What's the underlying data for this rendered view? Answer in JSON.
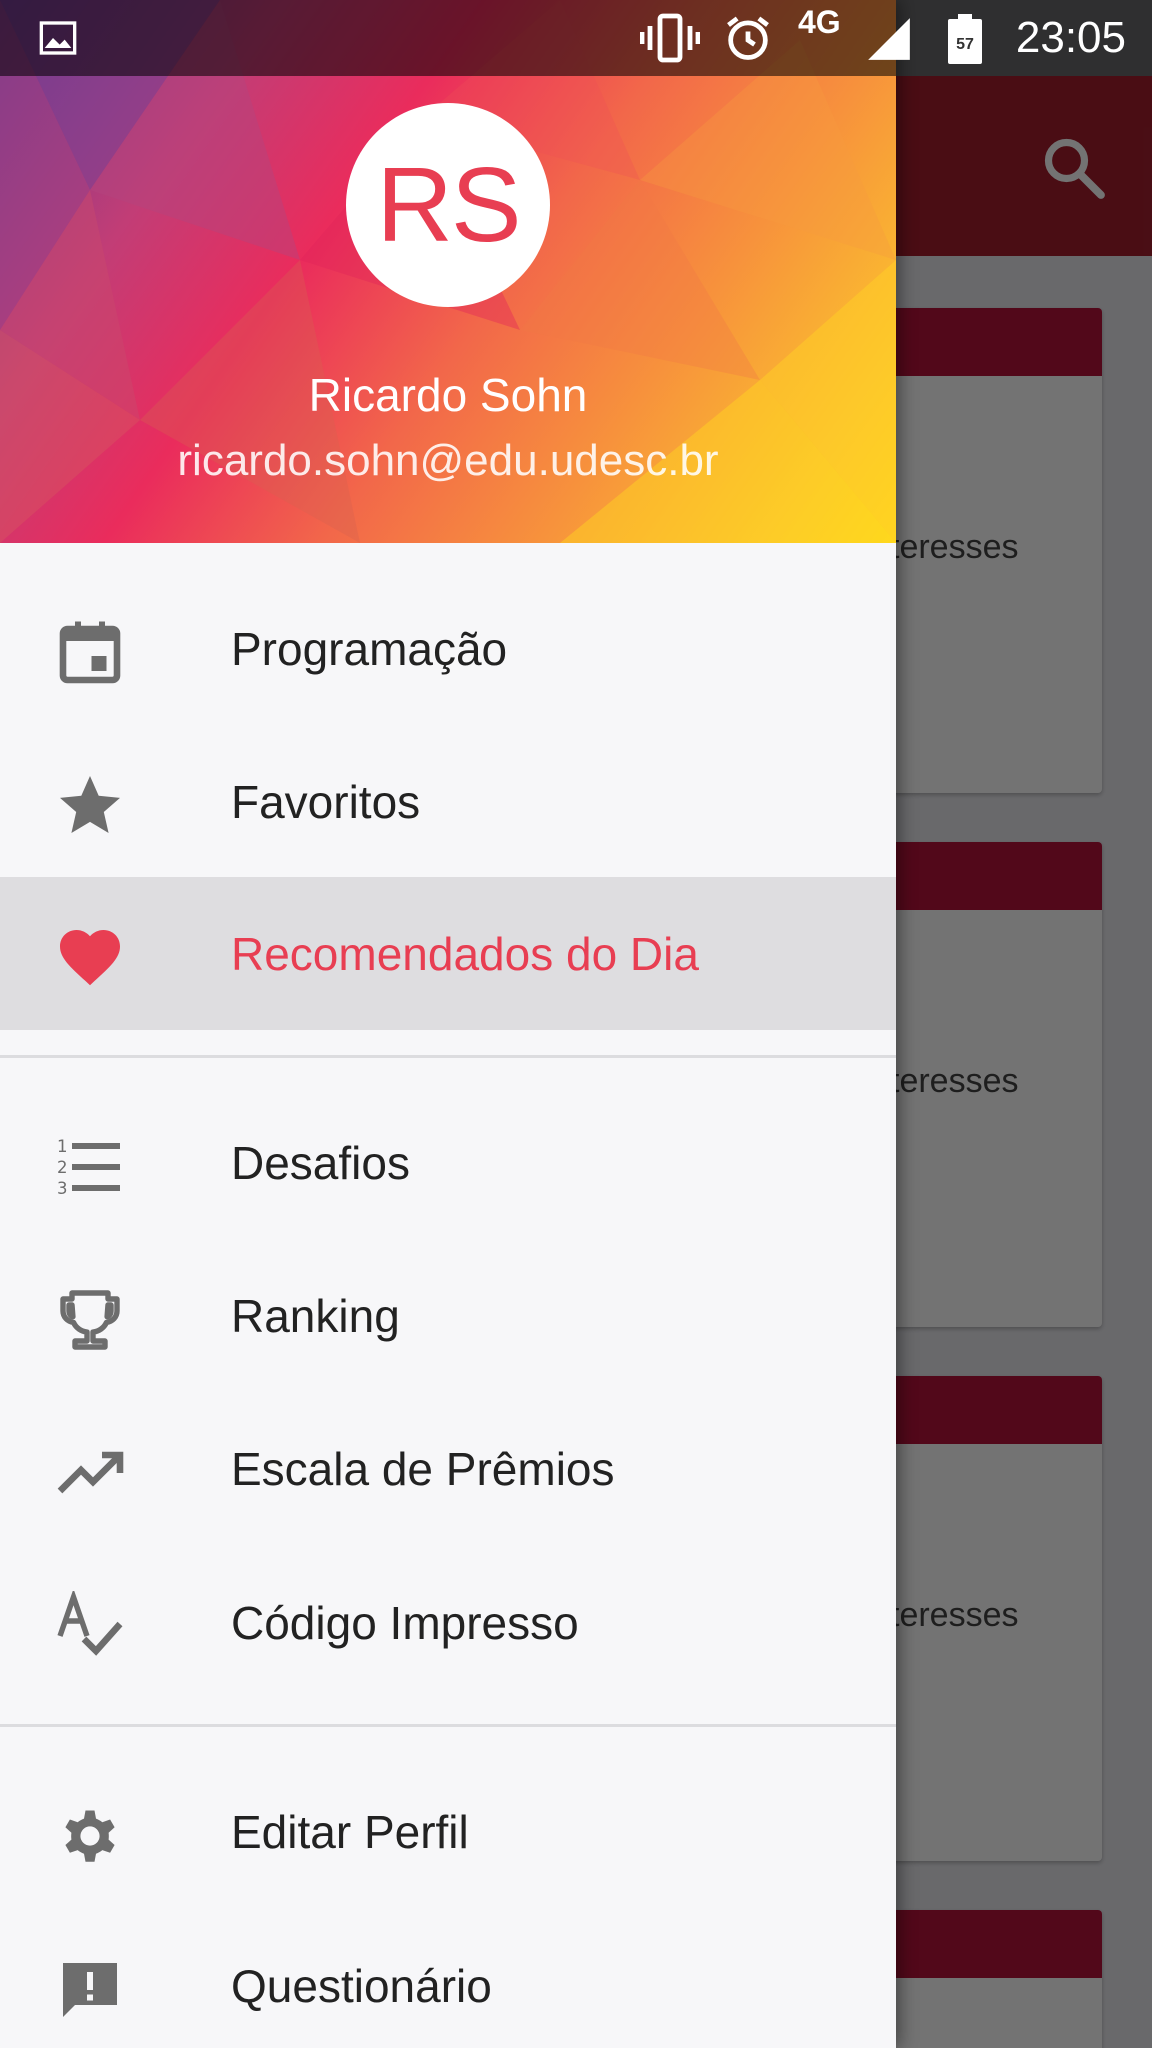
{
  "status_bar": {
    "time": "23:05",
    "network": "4G",
    "battery_level": "57",
    "icons": [
      "image-icon",
      "vibrate-icon",
      "alarm-icon",
      "signal-icon",
      "battery-icon"
    ]
  },
  "background": {
    "card_snippets": [
      "teresses",
      "teresses",
      "teresses"
    ],
    "toolbar_color": "#a51e2e",
    "card_header_color": "#b5123a"
  },
  "drawer": {
    "header": {
      "avatar_initials": "RS",
      "name": "Ricardo Sohn",
      "email": "ricardo.sohn@edu.udesc.br"
    },
    "items": [
      {
        "label": "Programação",
        "icon": "calendar-icon"
      },
      {
        "label": "Favoritos",
        "icon": "star-icon"
      },
      {
        "label": "Recomendados do Dia",
        "icon": "heart-icon",
        "active": true
      },
      {
        "label": "Desafios",
        "icon": "numbered-list-icon"
      },
      {
        "label": "Ranking",
        "icon": "trophy-icon"
      },
      {
        "label": "Escala de Prêmios",
        "icon": "trending-up-icon"
      },
      {
        "label": "Código Impresso",
        "icon": "spellcheck-icon"
      },
      {
        "label": "Editar Perfil",
        "icon": "gear-icon"
      },
      {
        "label": "Questionário",
        "icon": "feedback-icon"
      }
    ],
    "accent_color": "#e83e52"
  }
}
